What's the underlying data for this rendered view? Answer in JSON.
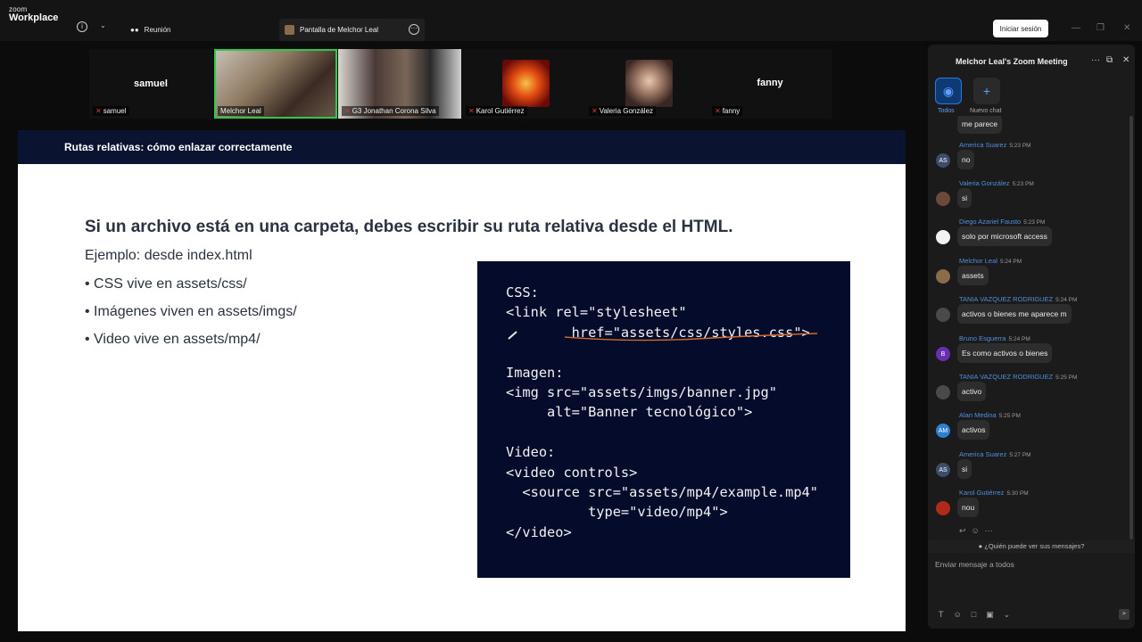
{
  "app": {
    "logo_line1": "zoom",
    "logo_line2": "Workplace",
    "meeting_tab": "Reunión",
    "share_tab": "Pantalla de Melchor Leal",
    "signin": "Iniciar sesión"
  },
  "participants": [
    {
      "display": "samuel",
      "tag": "samuel",
      "muted": true
    },
    {
      "display": "",
      "tag": "Melchor Leal",
      "muted": false,
      "active": true
    },
    {
      "display": "",
      "tag": "G3 Jonathan Corona Silva",
      "muted": true
    },
    {
      "display": "",
      "tag": "Karol Gutiérrez",
      "muted": true
    },
    {
      "display": "",
      "tag": "Valeria González",
      "muted": true
    },
    {
      "display": "fanny",
      "tag": "fanny",
      "muted": true
    }
  ],
  "slide": {
    "header": "Rutas relativas: cómo enlazar correctamente",
    "title": "Si un archivo está en una carpeta, debes escribir su ruta relativa desde el HTML.",
    "example": "Ejemplo: desde index.html",
    "bullets": [
      "• CSS vive en assets/css/",
      "• Imágenes viven en assets/imgs/",
      "• Video vive en assets/mp4/"
    ],
    "code": "CSS:\n<link rel=\"stylesheet\"\n        href=\"assets/css/styles.css\">\n\nImagen:\n<img src=\"assets/imgs/banner.jpg\"\n     alt=\"Banner tecnológico\">\n\nVideo:\n<video controls>\n  <source src=\"assets/mp4/example.mp4\"\n          type=\"video/mp4\">\n</video>"
  },
  "chat": {
    "title": "Melchor Leal's Zoom Meeting",
    "tab_all": "Todos",
    "tab_new": "Nuevo chat",
    "partial_message": "me parece",
    "messages": [
      {
        "name": "America Suarez",
        "time": "5:23 PM",
        "text": "no",
        "avatar": "AS",
        "color": "#3b4d6b"
      },
      {
        "name": "Valeria González",
        "time": "5:23 PM",
        "text": "si",
        "avatar": "",
        "color": "#6b4a3a"
      },
      {
        "name": "Diego Azariel Fausto",
        "time": "5:23 PM",
        "text": "solo por microsoft access",
        "avatar": "",
        "color": "#f2f2f2"
      },
      {
        "name": "Melchor Leal",
        "time": "5:24 PM",
        "text": "assets",
        "avatar": "",
        "color": "#8a6b4a"
      },
      {
        "name": "TANIA VAZQUEZ RODRIGUEZ",
        "time": "5:24 PM",
        "text": "activos o bienes me aparece m",
        "avatar": "",
        "color": "#4a4a4a"
      },
      {
        "name": "Bruno Esguerra",
        "time": "5:24 PM",
        "text": "Es como activos o bienes",
        "avatar": "B",
        "color": "#6a2fb0"
      },
      {
        "name": "TANIA VAZQUEZ RODRIGUEZ",
        "time": "5:25 PM",
        "text": "activo",
        "avatar": "",
        "color": "#4a4a4a"
      },
      {
        "name": "Alan Medina",
        "time": "5:25 PM",
        "text": "activos",
        "avatar": "AM",
        "color": "#2f7fd0"
      },
      {
        "name": "America Suarez",
        "time": "5:27 PM",
        "text": "si",
        "avatar": "AS",
        "color": "#3b4d6b"
      },
      {
        "name": "Karol Gutiérrez",
        "time": "5:30 PM",
        "text": "nou",
        "avatar": "",
        "color": "#b02a1a"
      }
    ],
    "who_can_see": "¿Quién puede ver sus mensajes?",
    "compose_placeholder": "Enviar mensaje a todos"
  }
}
